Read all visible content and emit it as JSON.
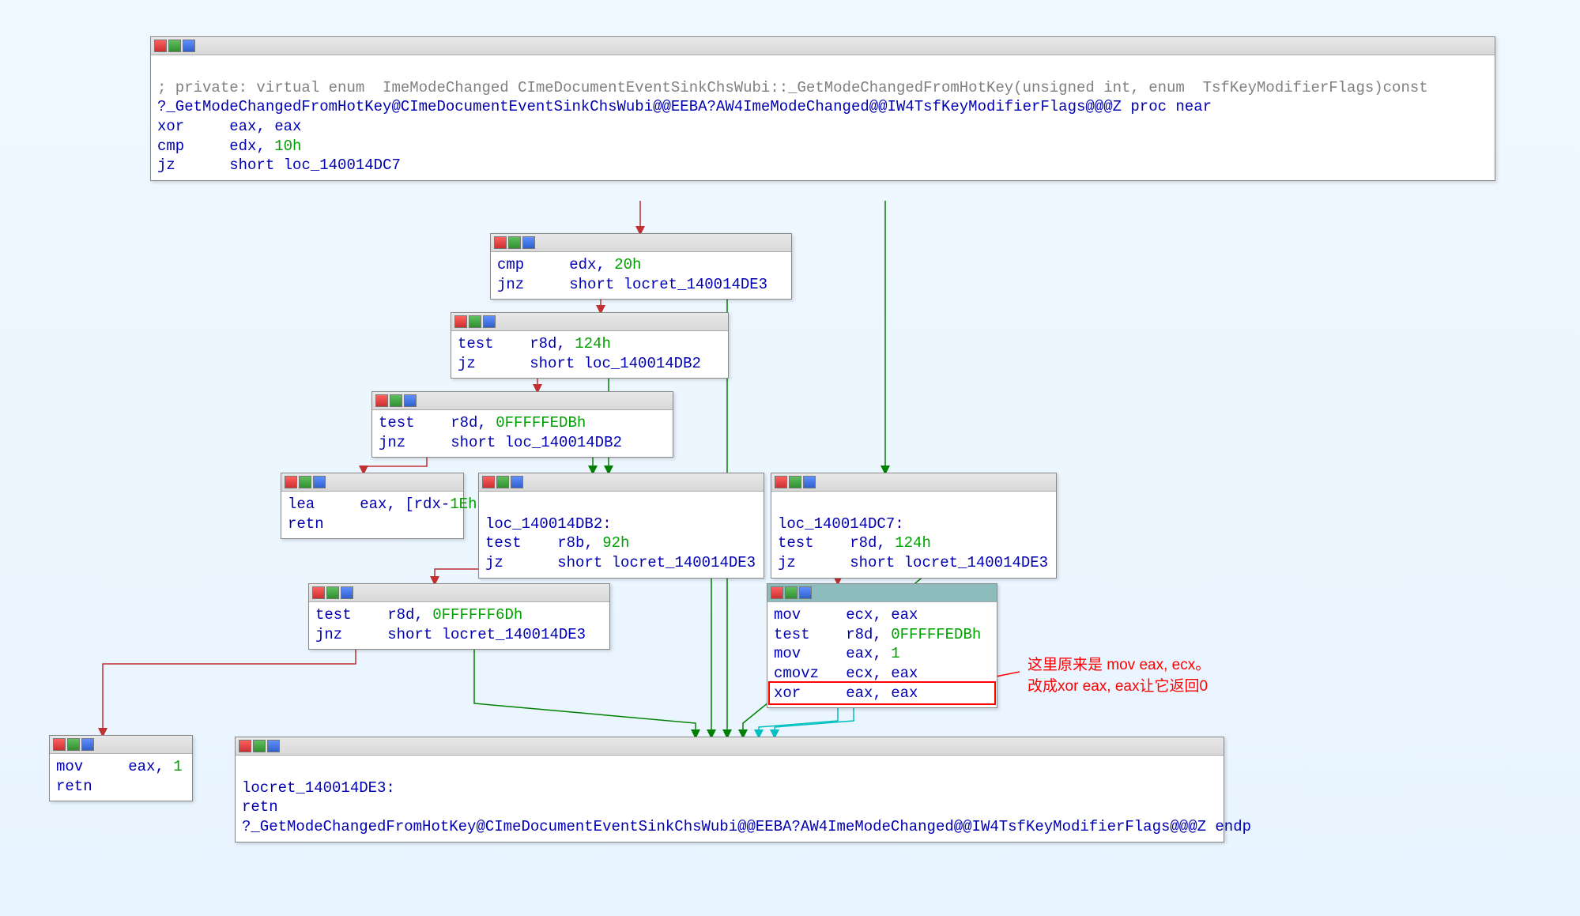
{
  "nodes": {
    "n1": {
      "comment": "; private: virtual enum  ImeModeChanged CImeDocumentEventSinkChsWubi::_GetModeChangedFromHotKey(unsigned int, enum  TsfKeyModifierFlags)const",
      "proc": "?_GetModeChangedFromHotKey@CImeDocumentEventSinkChsWubi@@EEBA?AW4ImeModeChanged@@IW4TsfKeyModifierFlags@@@Z proc near",
      "l1a": "xor",
      "l1b": "eax, eax",
      "l2a": "cmp",
      "l2b": "edx, ",
      "l2c": "10h",
      "l3a": "jz",
      "l3b": "short loc_140014DC7"
    },
    "n2": {
      "l1a": "cmp",
      "l1b": "edx, ",
      "l1c": "20h",
      "l2a": "jnz",
      "l2b": "short locret_140014DE3"
    },
    "n3": {
      "l1a": "test",
      "l1b": "r8d, ",
      "l1c": "124h",
      "l2a": "jz",
      "l2b": "short loc_140014DB2"
    },
    "n4": {
      "l1a": "test",
      "l1b": "r8d, ",
      "l1c": "0FFFFFEDBh",
      "l2a": "jnz",
      "l2b": "short loc_140014DB2"
    },
    "n5": {
      "l1a": "lea",
      "l1b": "eax, [rdx-",
      "l1c": "1Eh",
      "l1d": "]",
      "l2a": "retn"
    },
    "n6": {
      "lbl": "loc_140014DB2:",
      "l1a": "test",
      "l1b": "r8b, ",
      "l1c": "92h",
      "l2a": "jz",
      "l2b": "short locret_140014DE3"
    },
    "n7": {
      "l1a": "test",
      "l1b": "r8d, ",
      "l1c": "0FFFFFF6Dh",
      "l2a": "jnz",
      "l2b": "short locret_140014DE3"
    },
    "n8": {
      "lbl": "loc_140014DC7:",
      "l1a": "test",
      "l1b": "r8d, ",
      "l1c": "124h",
      "l2a": "jz",
      "l2b": "short locret_140014DE3"
    },
    "n9": {
      "l1a": "mov",
      "l1b": "ecx, eax",
      "l2a": "test",
      "l2b": "r8d, ",
      "l2c": "0FFFFFEDBh",
      "l3a": "mov",
      "l3b": "eax, ",
      "l3c": "1",
      "l4a": "cmovz",
      "l4b": "ecx, eax",
      "l5a": "xor",
      "l5b": "eax, eax"
    },
    "n10": {
      "l1a": "mov",
      "l1b": "eax, ",
      "l1c": "1",
      "l2a": "retn"
    },
    "n11": {
      "lbl": "locret_140014DE3:",
      "l1a": "retn",
      "endp": "?_GetModeChangedFromHotKey@CImeDocumentEventSinkChsWubi@@EEBA?AW4ImeModeChanged@@IW4TsfKeyModifierFlags@@@Z endp"
    }
  },
  "annotation": {
    "line1": "这里原来是 mov eax, ecx。",
    "line2": "改成xor eax, eax让它返回0"
  }
}
